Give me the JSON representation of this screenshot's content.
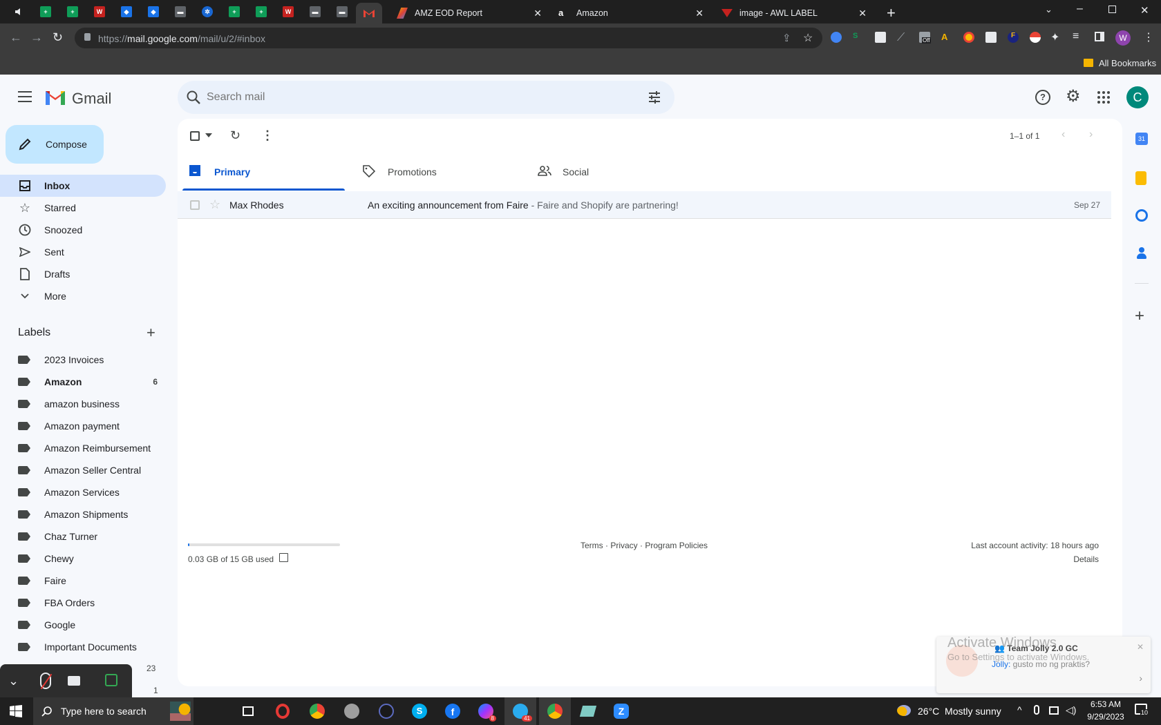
{
  "browser": {
    "tabs": [
      {
        "title": "AMZ EOD Report"
      },
      {
        "title": "Amazon"
      },
      {
        "title": "image - AWL LABEL"
      }
    ],
    "url_prefix": "https://",
    "url_host": "mail.google.com",
    "url_path": "/mail/u/2/#inbox",
    "bookmarks_label": "All Bookmarks",
    "profile_initial": "W",
    "ext_badge": "Off"
  },
  "gmail": {
    "brand": "Gmail",
    "search_placeholder": "Search mail",
    "avatar_initial": "C",
    "compose_label": "Compose",
    "nav": [
      {
        "label": "Inbox",
        "icon": "inbox-icon"
      },
      {
        "label": "Starred",
        "icon": "star-icon"
      },
      {
        "label": "Snoozed",
        "icon": "clock-icon"
      },
      {
        "label": "Sent",
        "icon": "send-icon"
      },
      {
        "label": "Drafts",
        "icon": "draft-icon"
      },
      {
        "label": "More",
        "icon": "chevron-down-icon"
      }
    ],
    "labels_heading": "Labels",
    "labels": [
      {
        "name": "2023 Invoices",
        "count": ""
      },
      {
        "name": "Amazon",
        "count": "6"
      },
      {
        "name": "amazon business",
        "count": ""
      },
      {
        "name": "Amazon payment",
        "count": ""
      },
      {
        "name": "Amazon Reimbursement",
        "count": ""
      },
      {
        "name": "Amazon Seller Central",
        "count": ""
      },
      {
        "name": "Amazon Services",
        "count": ""
      },
      {
        "name": "Amazon Shipments",
        "count": ""
      },
      {
        "name": "Chaz Turner",
        "count": ""
      },
      {
        "name": "Chewy",
        "count": ""
      },
      {
        "name": "Faire",
        "count": ""
      },
      {
        "name": "FBA Orders",
        "count": ""
      },
      {
        "name": "Google",
        "count": ""
      },
      {
        "name": "Important Documents",
        "count": ""
      }
    ],
    "hidden_counts": [
      "23",
      "1"
    ],
    "pagination": "1–1 of 1",
    "tabs": [
      {
        "label": "Primary"
      },
      {
        "label": "Promotions"
      },
      {
        "label": "Social"
      }
    ],
    "emails": [
      {
        "sender": "Max Rhodes",
        "subject": "An exciting announcement from Faire",
        "snippet": " - Faire and Shopify are partnering!",
        "date": "Sep 27"
      }
    ],
    "storage_text": "0.03 GB of 15 GB used",
    "storage_fraction": 0.002,
    "footer_links": {
      "terms": "Terms",
      "privacy": "Privacy",
      "policies": "Program Policies",
      "sep": " · "
    },
    "last_activity": "Last account activity: 18 hours ago",
    "details_link": "Details"
  },
  "notification": {
    "title": "Team Jolly 2.0 GC",
    "sender": "Jolly:",
    "message": " gusto mo ng praktis?",
    "watermark_1": "Activate Windows",
    "watermark_2": "Go to Settings to activate Windows."
  },
  "taskbar": {
    "search_placeholder": "Type here to search",
    "weather": "26°C  Mostly sunny",
    "time": "6:53 AM",
    "date": "9/29/2023",
    "notif_count": "10",
    "badge_messenger": "8",
    "badge_telegram": "41"
  },
  "colors": {
    "gmail_bg": "#f6f8fc",
    "compose_bg": "#c2e7ff",
    "inbox_active": "#d3e3fd",
    "primary_tab": "#0b57d0",
    "avatar": "#00897b"
  }
}
